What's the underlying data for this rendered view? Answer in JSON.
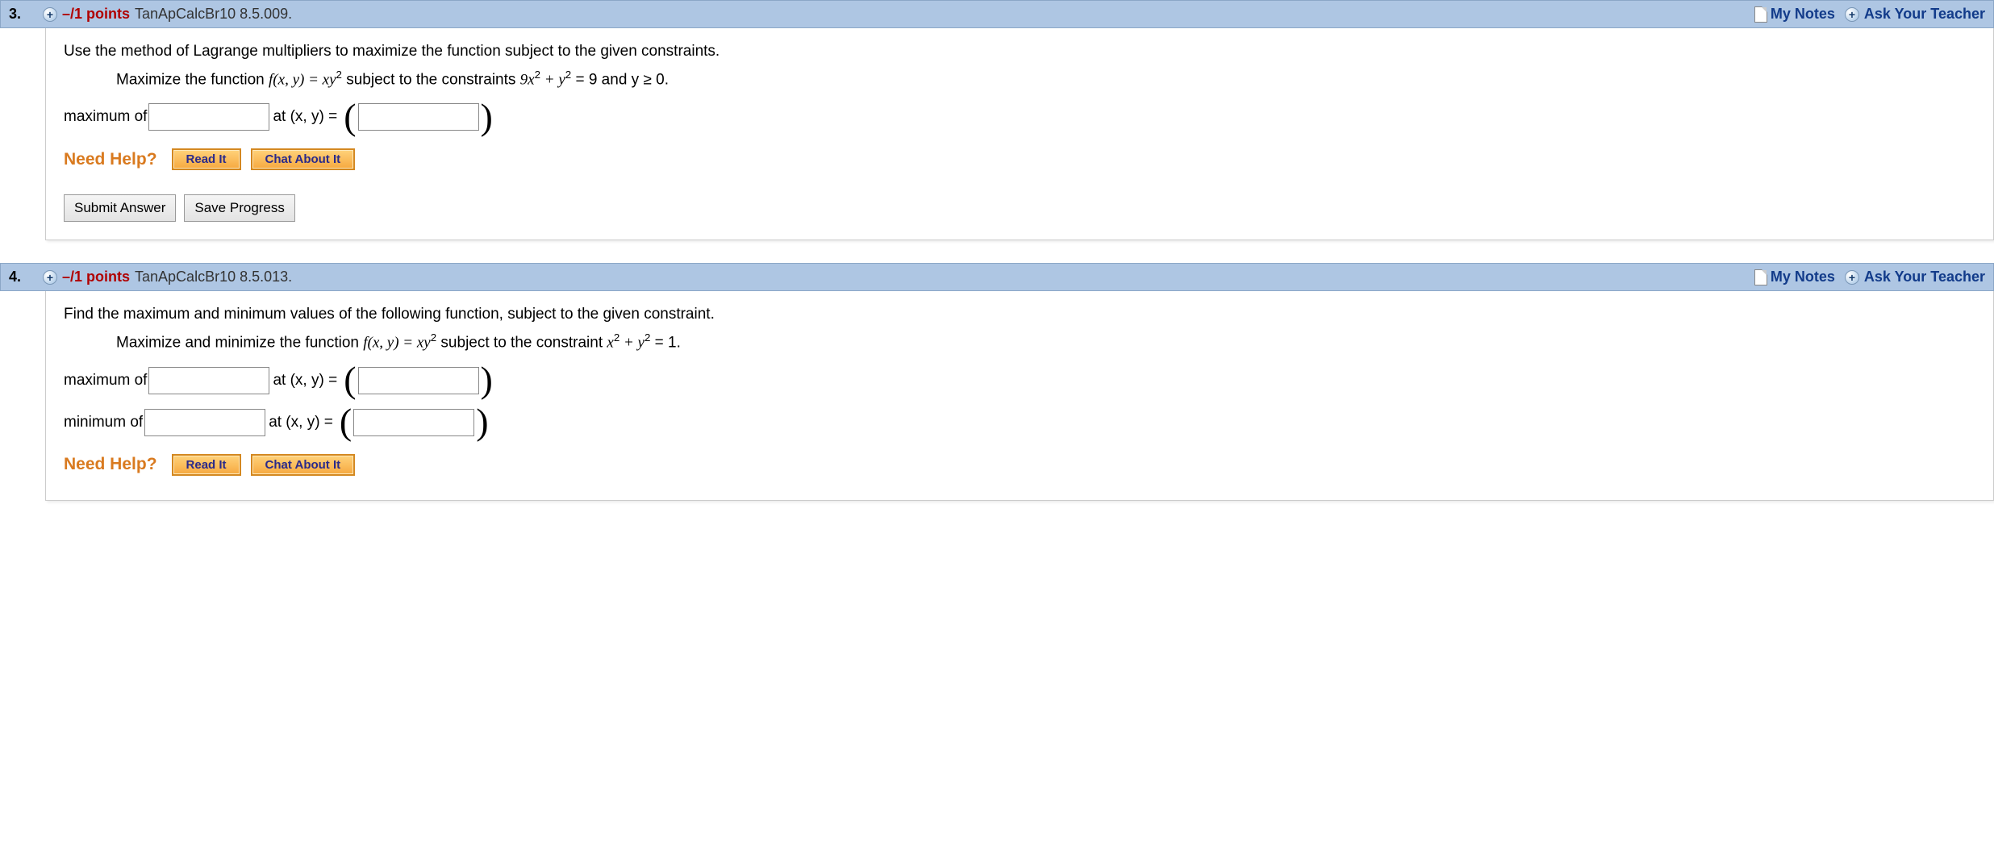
{
  "header": {
    "my_notes": "My Notes",
    "ask_teacher": "Ask Your Teacher"
  },
  "need_help": {
    "label": "Need Help?",
    "read_it": "Read It",
    "chat_about_it": "Chat About It"
  },
  "buttons": {
    "submit": "Submit Answer",
    "save": "Save Progress"
  },
  "questions": [
    {
      "number": "3.",
      "points": "–/1 points",
      "source": "TanApCalcBr10 8.5.009.",
      "prompt": "Use the method of Lagrange multipliers to maximize the function subject to the given constraints.",
      "subprompt_prefix": "Maximize the function  ",
      "func_label": "f(x, y) = xy",
      "func_sup": "2",
      "sub_mid": "  subject to the constraints  ",
      "constraint_lhs": "9x",
      "constraint_sup1": "2",
      "constraint_plus": " + y",
      "constraint_sup2": "2",
      "constraint_rhs": " = 9 and y ≥ 0.",
      "rows": [
        {
          "label": "maximum of",
          "atxy": "at  (x, y)  = "
        }
      ],
      "show_submit": true
    },
    {
      "number": "4.",
      "points": "–/1 points",
      "source": "TanApCalcBr10 8.5.013.",
      "prompt": "Find the maximum and minimum values of the following function, subject to the given constraint.",
      "subprompt_prefix": "Maximize and minimize the function  ",
      "func_label": "f(x, y) = xy",
      "func_sup": "2",
      "sub_mid": "  subject to the constraint  ",
      "constraint_lhs": "x",
      "constraint_sup1": "2",
      "constraint_plus": " + y",
      "constraint_sup2": "2",
      "constraint_rhs": " = 1.",
      "rows": [
        {
          "label": "maximum of",
          "atxy": "at (x, y)  = "
        },
        {
          "label": "minimum of",
          "atxy": "at (x, y)  = "
        }
      ],
      "show_submit": false
    }
  ]
}
